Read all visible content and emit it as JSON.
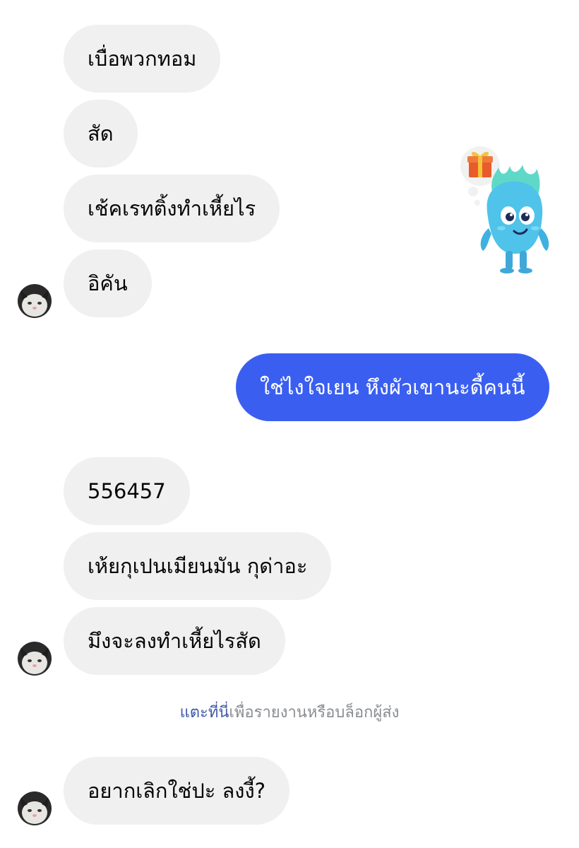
{
  "messages": [
    {
      "text": "เบื่อพวกทอม"
    },
    {
      "text": "สัด"
    },
    {
      "text": "เช้คเรทติ้งทำเหี้ยไร"
    },
    {
      "text": "อิคัน"
    },
    {
      "text": "ใช่ไงใจเยน หึงผัวเขานะดี้คนนี้"
    },
    {
      "text": "556457"
    },
    {
      "text": "เห้ยกุเปนเมียนมัน กุด่าอะ"
    },
    {
      "text": "มึงจะลงทำเหี้ยไรสัด"
    },
    {
      "text": "อยากเลิกใช่ปะ ลงงี้?"
    }
  ],
  "notice": {
    "link_text": "แตะที่นี่",
    "rest_text": "เพื่อรายงานหรือบล็อกผู้ส่ง"
  },
  "colors": {
    "incoming_bubble": "#f0f0f0",
    "outgoing_bubble": "#3a5ff0",
    "link": "#3f5aa8"
  },
  "icons": {
    "sticker": "gift-monster-sticker",
    "avatar": "cat-avatar"
  }
}
